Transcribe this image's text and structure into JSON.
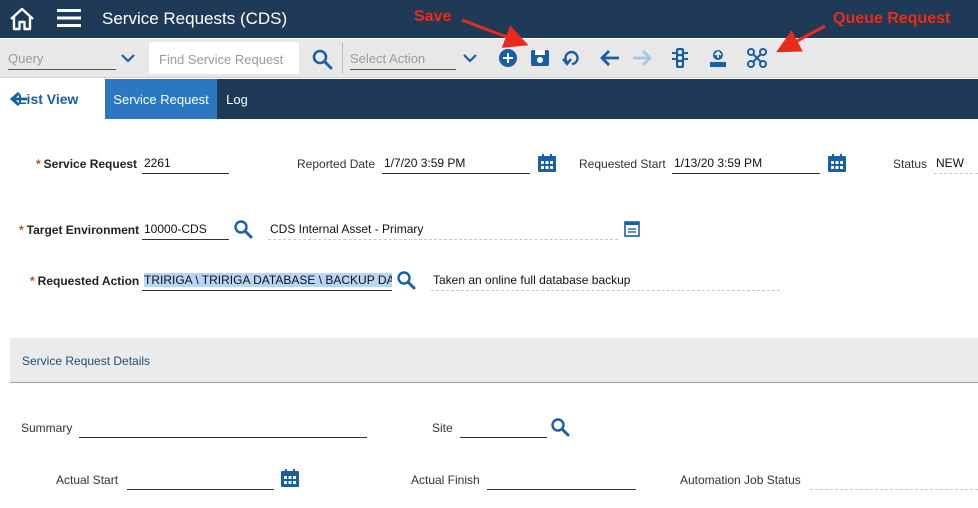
{
  "header": {
    "title": "Service Requests (CDS)",
    "bg_color": "#1e3a57"
  },
  "toolbar": {
    "query_placeholder": "Query",
    "find_placeholder": "Find Service Request",
    "action_placeholder": "Select Action",
    "icons": [
      "plus-circle-icon",
      "save-icon",
      "undo-icon",
      "arrow-left-icon",
      "arrow-right-icon",
      "traffic-light-icon",
      "upload-icon",
      "queue-request-icon"
    ]
  },
  "tabs": {
    "list_view": "List View",
    "service_request": "Service Request",
    "log": "Log"
  },
  "form": {
    "service_request_label": "Service Request",
    "service_request_value": "2261",
    "reported_date_label": "Reported Date",
    "reported_date_value": "1/7/20 3:59 PM",
    "requested_start_label": "Requested Start",
    "requested_start_value": "1/13/20 3:59 PM",
    "status_label": "Status",
    "status_value": "NEW",
    "target_env_label": "Target Environment",
    "target_env_value": "10000-CDS",
    "target_env_desc": "CDS Internal Asset - Primary",
    "requested_action_label": "Requested Action",
    "requested_action_value": "TRIRIGA \\ TRIRIGA DATABASE \\ BACKUP DAT.",
    "requested_action_desc": "Taken an online full database backup"
  },
  "details": {
    "section_title": "Service Request Details",
    "summary_label": "Summary",
    "summary_value": "",
    "site_label": "Site",
    "site_value": "",
    "actual_start_label": "Actual Start",
    "actual_start_value": "",
    "actual_finish_label": "Actual Finish",
    "actual_finish_value": "",
    "automation_job_status_label": "Automation Job Status",
    "automation_job_status_value": ""
  },
  "annotations": {
    "save": "Save",
    "queue_request": "Queue Request",
    "color": "#ea2a1c"
  },
  "colors": {
    "accent": "#2c77c2",
    "icon_blue": "#1a5fa6",
    "required": "#d0451b"
  }
}
